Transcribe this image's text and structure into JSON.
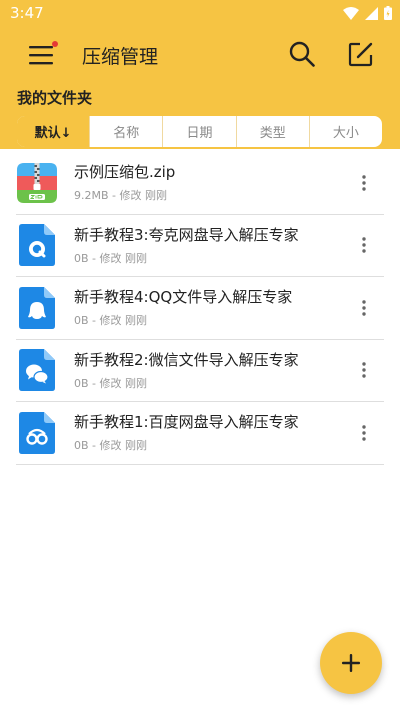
{
  "status": {
    "time": "3:47"
  },
  "app": {
    "title": "压缩管理"
  },
  "folder": {
    "title": "我的文件夹"
  },
  "sort_tabs": [
    {
      "label": "默认↓",
      "active": true
    },
    {
      "label": "名称",
      "active": false
    },
    {
      "label": "日期",
      "active": false
    },
    {
      "label": "类型",
      "active": false
    },
    {
      "label": "大小",
      "active": false
    }
  ],
  "files": [
    {
      "name": "示例压缩包.zip",
      "meta": "9.2MB - 修改 刚刚",
      "icon": "zip-archive-icon"
    },
    {
      "name": "新手教程3:夸克网盘导入解压专家",
      "meta": "0B - 修改 刚刚",
      "icon": "quark-doc-icon"
    },
    {
      "name": "新手教程4:QQ文件导入解压专家",
      "meta": "0B - 修改 刚刚",
      "icon": "qq-doc-icon"
    },
    {
      "name": "新手教程2:微信文件导入解压专家",
      "meta": "0B - 修改 刚刚",
      "icon": "wechat-doc-icon"
    },
    {
      "name": "新手教程1:百度网盘导入解压专家",
      "meta": "0B - 修改 刚刚",
      "icon": "baidu-doc-icon"
    }
  ],
  "colors": {
    "accent": "#f6c443",
    "doc_blue": "#1e88e5",
    "text": "#222222",
    "meta": "#9a9a9a"
  }
}
